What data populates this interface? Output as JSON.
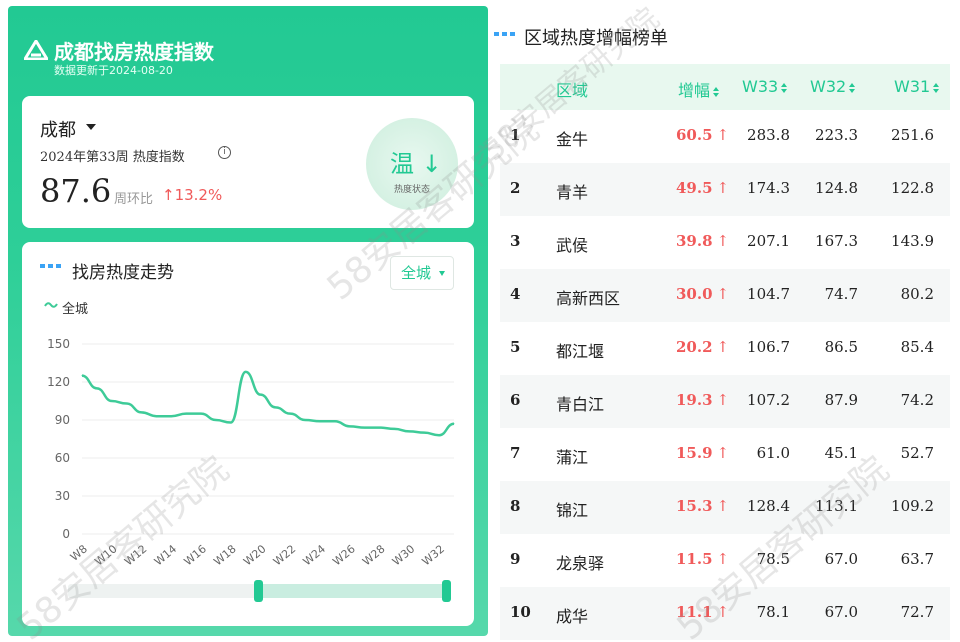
{
  "app": {
    "title": "成都找房热度指数",
    "update_text": "数据更新于2024-08-20"
  },
  "summary": {
    "city": "成都",
    "week_label": "2024年第33周 热度指数",
    "index_value": "87.6",
    "wow_label": "周环比",
    "wow_value": "↑13.2%",
    "status": "温 ↓",
    "status_caption": "热度状态"
  },
  "trend": {
    "title": "找房热度走势",
    "filter": "全城",
    "legend": "全城"
  },
  "chart_data": {
    "type": "line",
    "title": "找房热度走势",
    "xlabel": "",
    "ylabel": "",
    "ylim": [
      0,
      150
    ],
    "yticks": [
      "0",
      "30",
      "60",
      "90",
      "120",
      "150"
    ],
    "x": [
      "W8",
      "W9",
      "W10",
      "W11",
      "W12",
      "W13",
      "W14",
      "W15",
      "W16",
      "W17",
      "W18",
      "W19",
      "W20",
      "W21",
      "W22",
      "W23",
      "W24",
      "W25",
      "W26",
      "W27",
      "W28",
      "W29",
      "W30",
      "W31",
      "W32",
      "W33"
    ],
    "xtick_labels": [
      "W8",
      "W10",
      "W12",
      "W14",
      "W16",
      "W18",
      "W20",
      "W22",
      "W24",
      "W26",
      "W28",
      "W30",
      "W32"
    ],
    "series": [
      {
        "name": "全城",
        "values": [
          125,
          115,
          105,
          103,
          96,
          93,
          93,
          95,
          95,
          90,
          88,
          128,
          110,
          100,
          95,
          90,
          89,
          89,
          85,
          84,
          84,
          83,
          81,
          80,
          78,
          87
        ]
      }
    ],
    "color": "#3ecb98",
    "grid": true
  },
  "ranking": {
    "title": "区域热度增幅榜单",
    "headers": {
      "rank": "",
      "area": "区域",
      "increase": "增幅",
      "w33": "W33",
      "w32": "W32",
      "w31": "W31"
    },
    "up_arrow": "↑",
    "rows": [
      {
        "rank": "1",
        "area": "金牛",
        "increase": "60.5",
        "w33": "283.8",
        "w32": "223.3",
        "w31": "251.6"
      },
      {
        "rank": "2",
        "area": "青羊",
        "increase": "49.5",
        "w33": "174.3",
        "w32": "124.8",
        "w31": "122.8"
      },
      {
        "rank": "3",
        "area": "武侯",
        "increase": "39.8",
        "w33": "207.1",
        "w32": "167.3",
        "w31": "143.9"
      },
      {
        "rank": "4",
        "area": "高新西区",
        "increase": "30.0",
        "w33": "104.7",
        "w32": "74.7",
        "w31": "80.2"
      },
      {
        "rank": "5",
        "area": "都江堰",
        "increase": "20.2",
        "w33": "106.7",
        "w32": "86.5",
        "w31": "85.4"
      },
      {
        "rank": "6",
        "area": "青白江",
        "increase": "19.3",
        "w33": "107.2",
        "w32": "87.9",
        "w31": "74.2"
      },
      {
        "rank": "7",
        "area": "蒲江",
        "increase": "15.9",
        "w33": "61.0",
        "w32": "45.1",
        "w31": "52.7"
      },
      {
        "rank": "8",
        "area": "锦江",
        "increase": "15.3",
        "w33": "128.4",
        "w32": "113.1",
        "w31": "109.2"
      },
      {
        "rank": "9",
        "area": "龙泉驿",
        "increase": "11.5",
        "w33": "78.5",
        "w32": "67.0",
        "w31": "63.7"
      },
      {
        "rank": "10",
        "area": "成华",
        "increase": "11.1",
        "w33": "78.1",
        "w32": "67.0",
        "w31": "72.7"
      }
    ]
  },
  "watermark": "58安居客研究院",
  "colors": {
    "brand": "#22c993",
    "up": "#f05a5a",
    "accent_blue": "#3aa3f5"
  }
}
